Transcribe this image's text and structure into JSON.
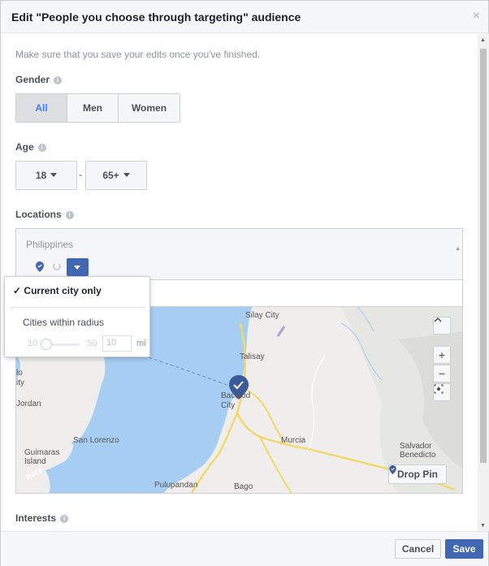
{
  "dialog": {
    "title": "Edit \"People you choose through targeting\" audience",
    "close_glyph": "×"
  },
  "hint": "Make sure that you save your edits once you've finished.",
  "gender": {
    "label": "Gender",
    "options": [
      "All",
      "Men",
      "Women"
    ],
    "selected": "All"
  },
  "age": {
    "label": "Age",
    "min": "18",
    "dash": "-",
    "max": "65+"
  },
  "locations": {
    "label": "Locations",
    "country": "Philippines",
    "dropdown": {
      "option_current_city": "Current city only",
      "check_glyph": "✓",
      "option_radius": "Cities within radius",
      "radius_min": "10",
      "radius_max": "50",
      "radius_value": "10",
      "radius_unit": "mi"
    },
    "map": {
      "labels": {
        "silay": "Silay City",
        "talisay": "Talisay",
        "bacolod": "Bacolod City",
        "murcia": "Murcia",
        "san_lorenzo": "San Lorenzo",
        "guimaras": "Guimaras Island",
        "jordan": "Jordan",
        "iloilo": "lo ity",
        "salvador": "Salvador Benedicto",
        "pulupandan": "Pulupandan",
        "bago": "Bago",
        "here": "here"
      },
      "zoom_in": "+",
      "zoom_out": "−",
      "drop_pin": "Drop Pin"
    }
  },
  "interests": {
    "label": "Interests"
  },
  "footer": {
    "cancel": "Cancel",
    "save": "Save"
  },
  "colors": {
    "accent": "#4267b2",
    "selected_text": "#4080ff",
    "water": "#a6cdf2",
    "road": "#f2d96b"
  }
}
